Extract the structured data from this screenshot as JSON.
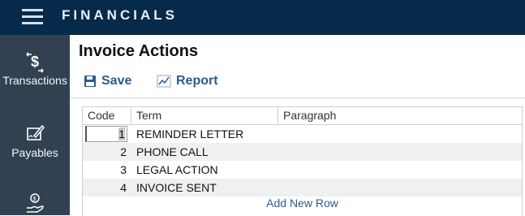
{
  "app": {
    "title": "FINANCIALS"
  },
  "sidebar": {
    "items": [
      {
        "label": "Transactions",
        "icon": "dollar-exchange-icon"
      },
      {
        "label": "Payables",
        "icon": "pen-signature-icon"
      },
      {
        "label": "",
        "icon": "hand-coin-icon"
      }
    ]
  },
  "page": {
    "title": "Invoice Actions"
  },
  "toolbar": {
    "save_label": "Save",
    "report_label": "Report"
  },
  "grid": {
    "columns": [
      "Code",
      "Term",
      "Paragraph"
    ],
    "rows": [
      {
        "code": "1",
        "term": "REMINDER LETTER",
        "paragraph": ""
      },
      {
        "code": "2",
        "term": "PHONE CALL",
        "paragraph": ""
      },
      {
        "code": "3",
        "term": "LEGAL ACTION",
        "paragraph": ""
      },
      {
        "code": "4",
        "term": "INVOICE SENT",
        "paragraph": ""
      }
    ],
    "add_row_label": "Add New Row"
  },
  "colors": {
    "topbar": "#062a4a",
    "sidebar": "#314152",
    "accent": "#2d5b8a",
    "alt_row": "#eef0f2"
  }
}
